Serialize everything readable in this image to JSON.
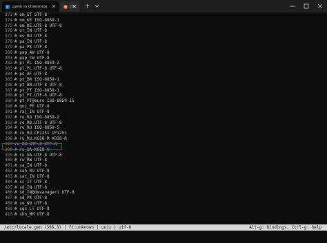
{
  "tabs": [
    {
      "label": "pwsh in chaosmos",
      "icon": "powershell-icon"
    },
    {
      "label": "mc",
      "icon": "ubuntu-icon"
    }
  ],
  "buffer": {
    "lines": [
      {
        "n": "373",
        "t": "# om_ET UTF-8"
      },
      {
        "n": "374",
        "t": "# om_KE ISO-8859-1"
      },
      {
        "n": "375",
        "t": "# om_KE.UTF-8 UTF-8"
      },
      {
        "n": "376",
        "t": "# or_IN UTF-8"
      },
      {
        "n": "377",
        "t": "# os_RU UTF-8"
      },
      {
        "n": "378",
        "t": "# pa_IN UTF-8"
      },
      {
        "n": "379",
        "t": "# pa_PK UTF-8"
      },
      {
        "n": "380",
        "t": "# pap_AW UTF-8"
      },
      {
        "n": "381",
        "t": "# pap_CW UTF-8"
      },
      {
        "n": "382",
        "t": "# pl_PL ISO-8859-2"
      },
      {
        "n": "383",
        "t": "# pl_PL.UTF-8 UTF-8"
      },
      {
        "n": "384",
        "t": "# ps_AF UTF-8"
      },
      {
        "n": "385",
        "t": "# pt_BR ISO-8859-1"
      },
      {
        "n": "386",
        "t": "# pt_BR.UTF-8 UTF-8"
      },
      {
        "n": "387",
        "t": "# pt_PT ISO-8859-1"
      },
      {
        "n": "388",
        "t": "# pt_PT.UTF-8 UTF-8"
      },
      {
        "n": "389",
        "t": "# pt_PT@euro ISO-8859-15"
      },
      {
        "n": "390",
        "t": "# quz_PE UTF-8"
      },
      {
        "n": "391",
        "t": "# raj_IN UTF-8"
      },
      {
        "n": "392",
        "t": "# ro_RO ISO-8859-2"
      },
      {
        "n": "393",
        "t": "# ro_RO.UTF-8 UTF-8"
      },
      {
        "n": "394",
        "t": "# ru_RU ISO-8859-5"
      },
      {
        "n": "395",
        "t": "# ru_RU.CP1251 CP1251"
      },
      {
        "n": "396",
        "t": "# ru_RU.KOI8-R KOI8-R"
      },
      {
        "n": "397",
        "t": "ru_RU.UTF-8 UTF-8"
      },
      {
        "n": "398",
        "t": "# ru_UA KOI8-U"
      },
      {
        "n": "399",
        "t": "# ru_UA.UTF-8 UTF-8"
      },
      {
        "n": "400",
        "t": "# rw_RW UTF-8"
      },
      {
        "n": "401",
        "t": "# sa_IN UTF-8"
      },
      {
        "n": "402",
        "t": "# sah_RU UTF-8"
      },
      {
        "n": "403",
        "t": "# sat_IN UTF-8"
      },
      {
        "n": "404",
        "t": "# sc_IT UTF-8"
      },
      {
        "n": "405",
        "t": "# sd_IN UTF-8"
      },
      {
        "n": "406",
        "t": "# sd_IN@devanagari UTF-8"
      },
      {
        "n": "407",
        "t": "# sd_PK UTF-8"
      },
      {
        "n": "408",
        "t": "# se_NO UTF-8"
      },
      {
        "n": "409",
        "t": "# sgs_LT UTF-8"
      },
      {
        "n": "410",
        "t": "# shn_MM UTF-8"
      }
    ]
  },
  "statusbar": {
    "left": "/etc/locale.gen (396,3) | ft:unknown | unix | utf-8",
    "right": "Alt-g: bindings, Ctrl-g: help"
  },
  "colors": {
    "highlight": "#d01818",
    "background": "#0c0c0c",
    "statusbar": "#d8d8d8"
  }
}
